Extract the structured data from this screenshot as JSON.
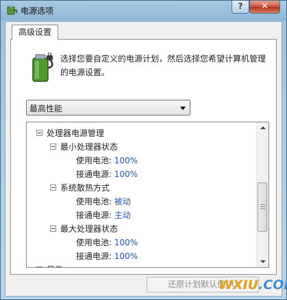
{
  "window": {
    "title": "电源选项"
  },
  "titlebar_buttons": {
    "help": "?",
    "close": "✕"
  },
  "tab": {
    "label": "高级设置"
  },
  "description": "选择您要自定义的电源计划，然后选择您希望计算机管理的电源设置。",
  "plan_select": {
    "value": "最高性能"
  },
  "tree": [
    {
      "label": "处理器电源管理",
      "level": 0,
      "toggle": "minus"
    },
    {
      "label": "最小处理器状态",
      "level": 1,
      "toggle": "minus"
    },
    {
      "label": "使用电池:",
      "value": "100%",
      "level": 2
    },
    {
      "label": "接通电源:",
      "value": "100%",
      "level": 2
    },
    {
      "label": "系统散热方式",
      "level": 1,
      "toggle": "minus"
    },
    {
      "label": "使用电池:",
      "value": "被动",
      "level": 2
    },
    {
      "label": "接通电源:",
      "value": "主动",
      "level": 2
    },
    {
      "label": "最大处理器状态",
      "level": 1,
      "toggle": "minus"
    },
    {
      "label": "使用电池:",
      "value": "100%",
      "level": 2
    },
    {
      "label": "接通电源:",
      "value": "100%",
      "level": 2
    },
    {
      "label": "显示",
      "level": 0,
      "toggle": "plus"
    }
  ],
  "restore_button": {
    "label": "还原计划默认值(R)"
  },
  "watermark": {
    "part_a": "WXIU",
    "part_b": ".COM"
  },
  "colors": {
    "value_text": "#1a56b8",
    "close_button": "#c9533a",
    "title_bar": "#a9cbe3"
  }
}
